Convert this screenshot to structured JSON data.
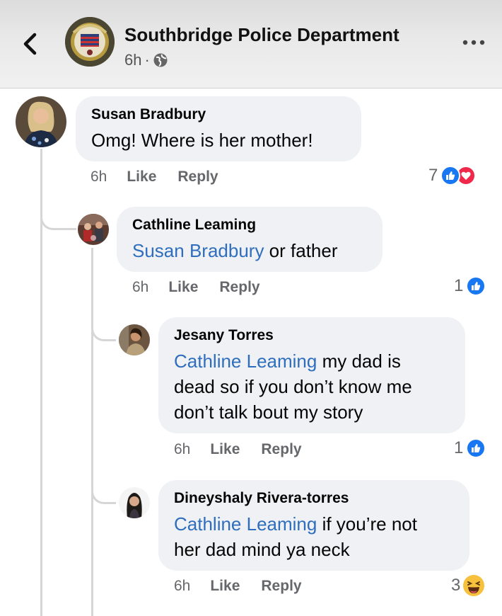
{
  "header": {
    "title": "Southbridge Police Department",
    "time": "6h",
    "separator": "·",
    "back_icon": "chevron-left-icon",
    "more_icon": "more-horizontal-icon",
    "audience_icon": "globe-icon"
  },
  "comments": [
    {
      "author": "Susan Bradbury",
      "mention": "",
      "text": "Omg! Where is her mother!",
      "time": "6h",
      "like": "Like",
      "reply": "Reply",
      "reaction_count": "7",
      "reactions": [
        "like",
        "love"
      ]
    },
    {
      "author": "Cathline Leaming",
      "mention": "Susan Bradbury",
      "text": " or father",
      "time": "6h",
      "like": "Like",
      "reply": "Reply",
      "reaction_count": "1",
      "reactions": [
        "like"
      ]
    },
    {
      "author": "Jesany Torres",
      "mention": "Cathline Leaming",
      "text_line1": " my dad is",
      "text_line2": "dead so if you don’t know me",
      "text_line3": "don’t talk bout my story",
      "time": "6h",
      "like": "Like",
      "reply": "Reply",
      "reaction_count": "1",
      "reactions": [
        "like"
      ]
    },
    {
      "author": "Dineyshaly Rivera-torres",
      "mention": "Cathline Leaming",
      "text_line1": " if you’re not",
      "text_line2": "her dad mind ya neck",
      "time": "6h",
      "like": "Like",
      "reply": "Reply",
      "reaction_count": "3",
      "reactions": [
        "haha"
      ]
    }
  ],
  "colors": {
    "like_blue": "#1877f2",
    "love_red": "#f02849",
    "haha_yellow": "#f7c13d",
    "mention_blue": "#2f6ebd",
    "bubble_bg": "#eff1f4"
  }
}
